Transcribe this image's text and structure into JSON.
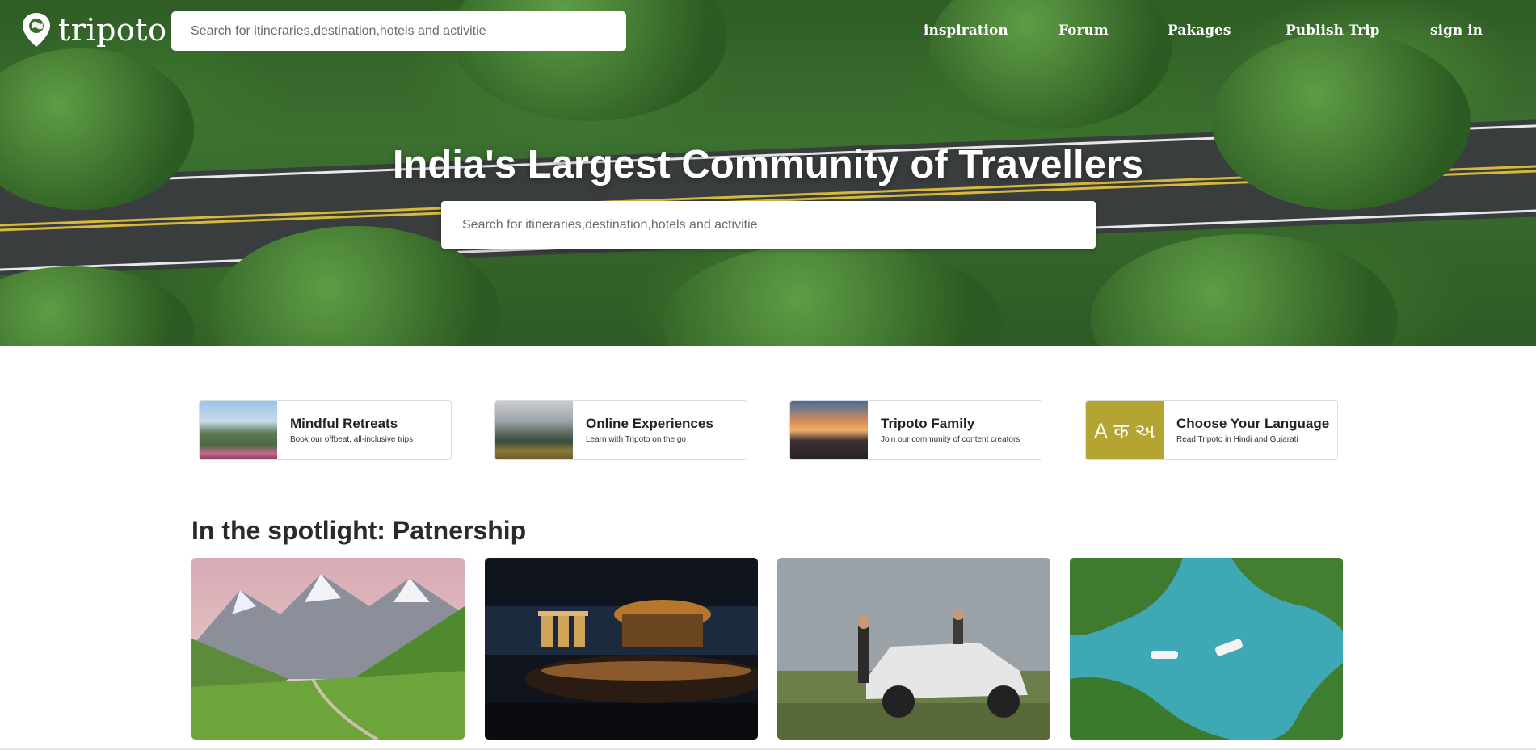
{
  "brand": {
    "name": "tripoto"
  },
  "nav": {
    "search_placeholder": "Search for itineraries,destination,hotels and activitie",
    "links": [
      "inspiration",
      "Forum",
      "Pakages",
      "Publish Trip",
      "sign in"
    ]
  },
  "hero": {
    "title": "India's Largest Community of Travellers",
    "search_placeholder": "Search for itineraries,destination,hotels and activitie"
  },
  "categories": [
    {
      "title": "Mindful Retreats",
      "subtitle": "Book our offbeat, all-inclusive trips"
    },
    {
      "title": "Online Experiences",
      "subtitle": "Learn with Tripoto on the go"
    },
    {
      "title": "Tripoto Family",
      "subtitle": "Join our community of content creators"
    },
    {
      "title": "Choose Your Language",
      "subtitle": "Read Tripoto in Hindi and Gujarati",
      "thumb_text": "A क અ"
    }
  ],
  "spotlight": {
    "title": "In the spotlight: Patnership",
    "cards": [
      {
        "image": "mountain-valley-photo"
      },
      {
        "image": "rooftop-bar-photo"
      },
      {
        "image": "couple-with-suv-photo"
      },
      {
        "image": "mangrove-boats-photo"
      }
    ]
  },
  "colors": {
    "accent_language_tile": "#b4a533",
    "tag_red": "#d33333"
  }
}
